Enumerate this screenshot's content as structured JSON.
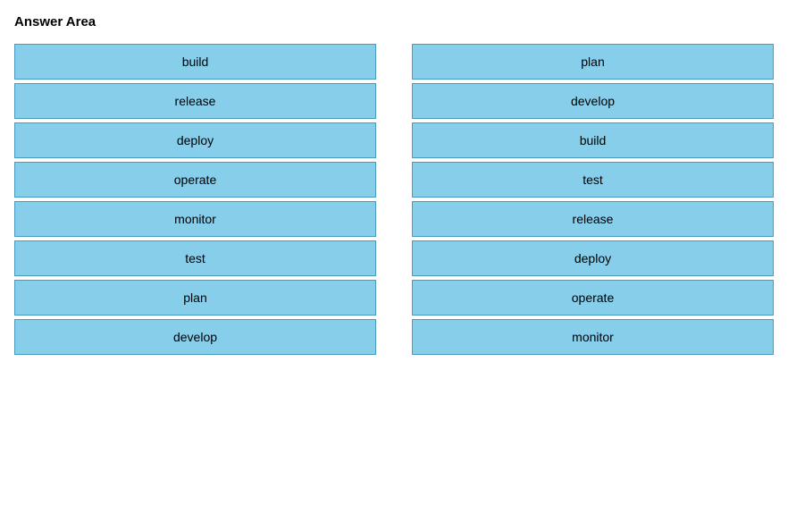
{
  "header": {
    "title": "Answer Area"
  },
  "left_column": {
    "items": [
      {
        "label": "build"
      },
      {
        "label": "release"
      },
      {
        "label": "deploy"
      },
      {
        "label": "operate"
      },
      {
        "label": "monitor"
      },
      {
        "label": "test"
      },
      {
        "label": "plan"
      },
      {
        "label": "develop"
      }
    ]
  },
  "right_column": {
    "items": [
      {
        "label": "plan"
      },
      {
        "label": "develop"
      },
      {
        "label": "build"
      },
      {
        "label": "test"
      },
      {
        "label": "release"
      },
      {
        "label": "deploy"
      },
      {
        "label": "operate"
      },
      {
        "label": "monitor"
      }
    ]
  }
}
